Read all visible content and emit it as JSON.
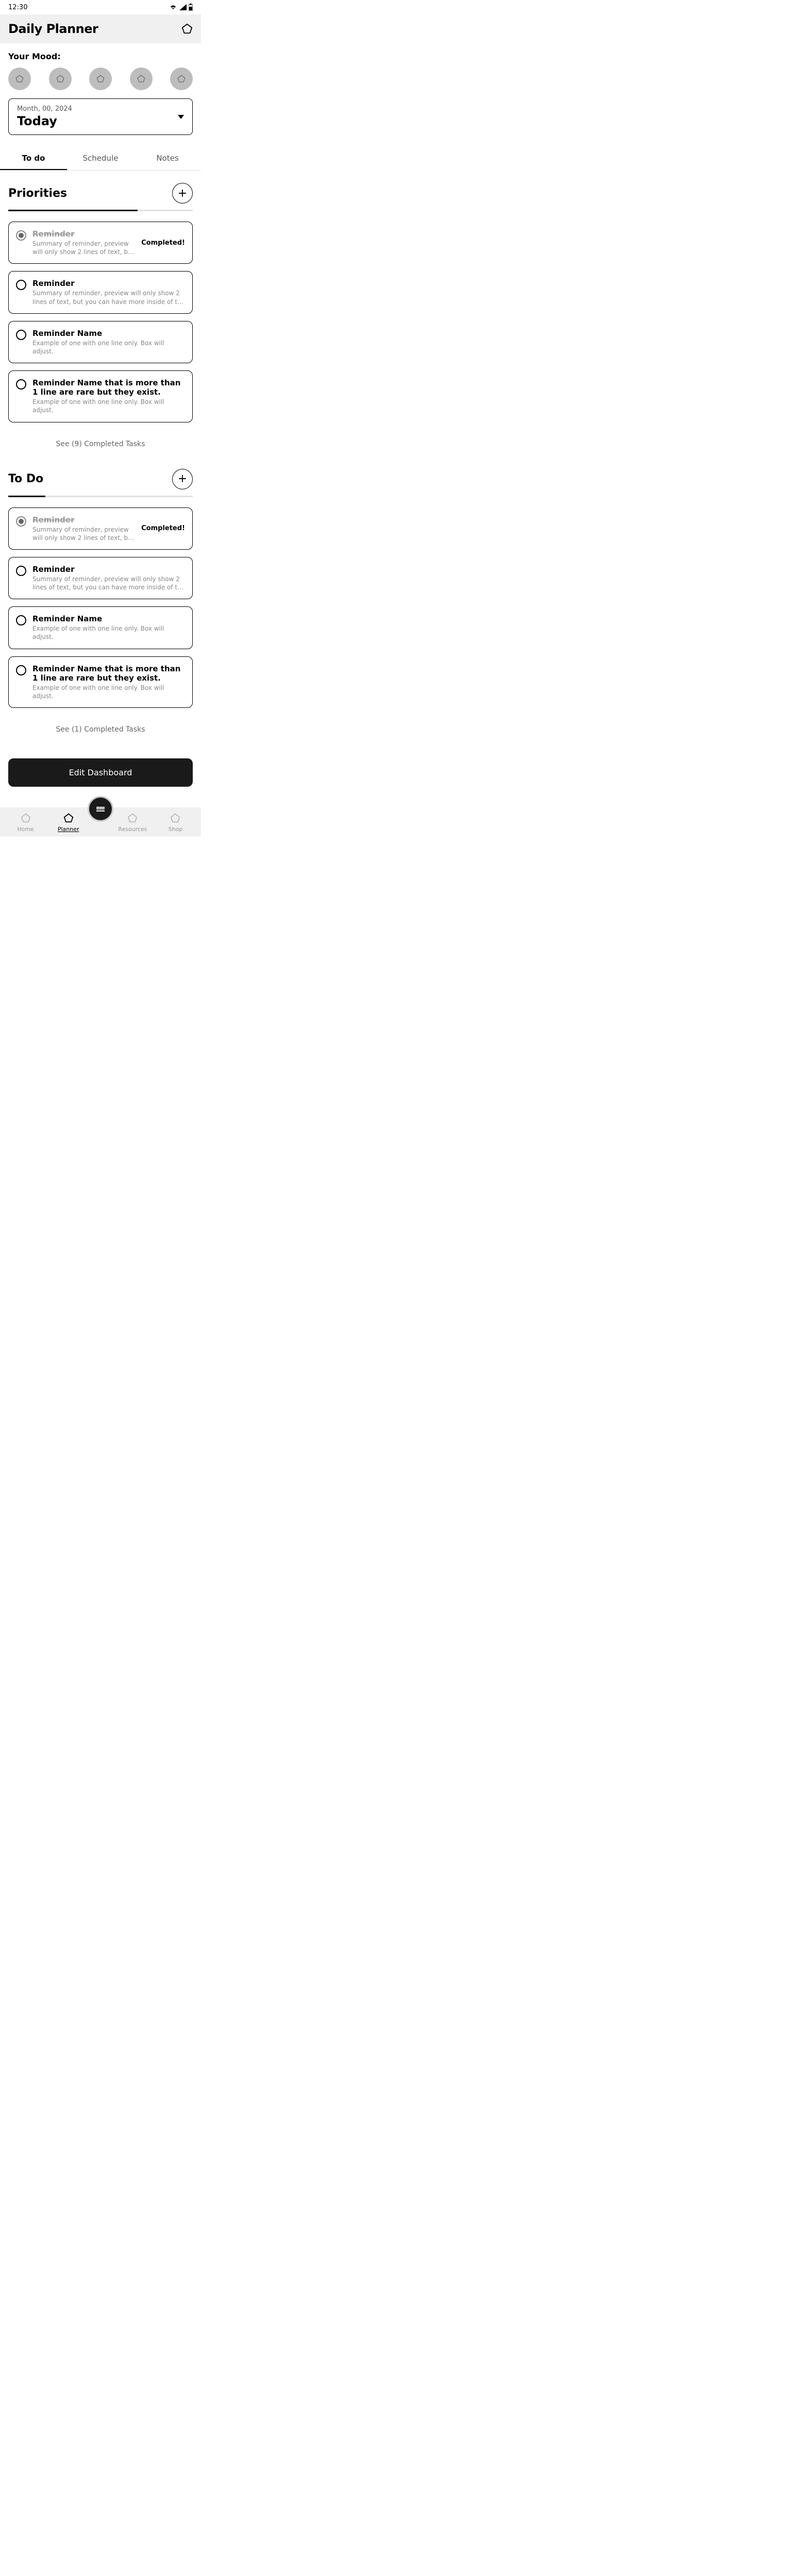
{
  "status": {
    "time": "12:30"
  },
  "header": {
    "title": "Daily Planner"
  },
  "mood": {
    "label": "Your Mood:"
  },
  "date": {
    "small": "Month, 00, 2024",
    "big": "Today"
  },
  "tabs": {
    "todo": "To do",
    "schedule": "Schedule",
    "notes": "Notes"
  },
  "groups": [
    {
      "title": "Priorities",
      "progress": 70,
      "tasks": [
        {
          "title": "Reminder",
          "summary": "Summary of reminder, preview will only show 2 lines of text, but you can have…",
          "done": true,
          "status": "Completed!"
        },
        {
          "title": "Reminder",
          "summary": "Summary of reminder, preview will only show 2 lines of text, but you can have more inside of the reminder.",
          "done": false,
          "status": ""
        },
        {
          "title": "Reminder Name",
          "summary": "Example of one with one line only. Box will adjust.",
          "done": false,
          "status": ""
        },
        {
          "title": "Reminder Name that is more than 1 line are rare but they exist.",
          "summary": "Example of one with one line only. Box will adjust.",
          "done": false,
          "status": ""
        }
      ],
      "completed_link": "See (9) Completed Tasks"
    },
    {
      "title": "To Do",
      "progress": 20,
      "tasks": [
        {
          "title": "Reminder",
          "summary": "Summary of reminder, preview will only show 2 lines of text, but you can have…",
          "done": true,
          "status": "Completed!"
        },
        {
          "title": "Reminder",
          "summary": "Summary of reminder, preview will only show 2 lines of text, but you can have more inside of the reminder.",
          "done": false,
          "status": ""
        },
        {
          "title": "Reminder Name",
          "summary": "Example of one with one line only. Box will adjust.",
          "done": false,
          "status": ""
        },
        {
          "title": "Reminder Name that is more than 1 line are rare but they exist.",
          "summary": "Example of one with one line only. Box will adjust.",
          "done": false,
          "status": ""
        }
      ],
      "completed_link": "See (1) Completed Tasks"
    }
  ],
  "edit_dashboard": "Edit Dashboard",
  "nav": {
    "home": "Home",
    "planner": "Planner",
    "resources": "Resources",
    "shop": "Shop"
  }
}
